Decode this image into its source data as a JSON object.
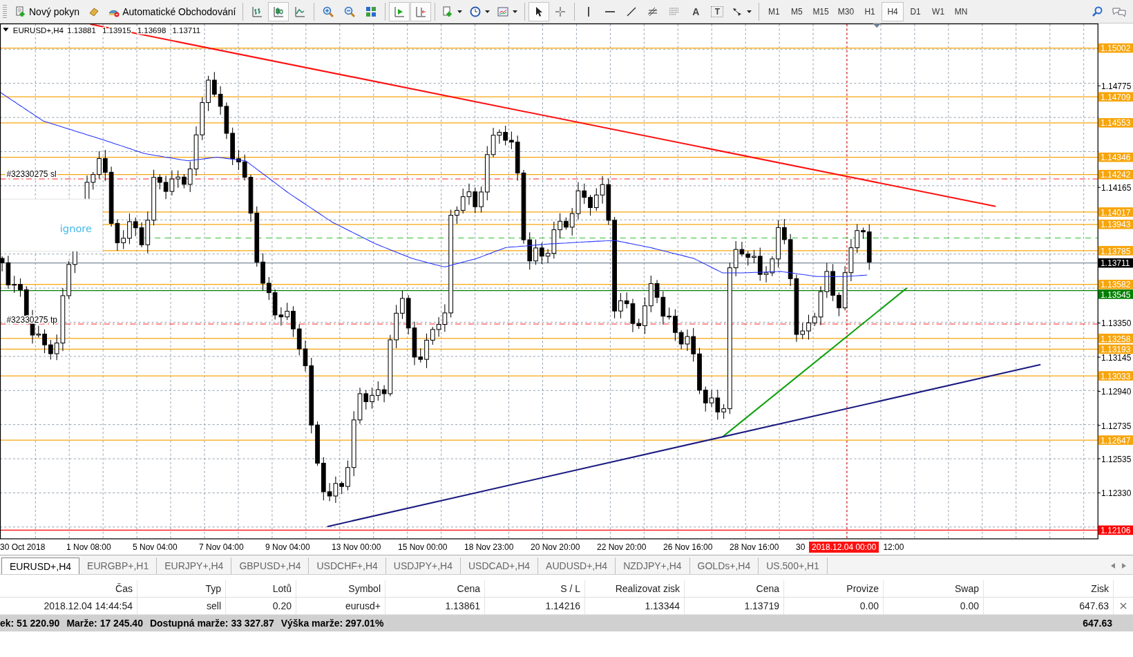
{
  "toolbar": {
    "groups": [
      [
        {
          "kind": "new-order",
          "label": "Nový pokyn",
          "selected": false
        },
        {
          "kind": "gold",
          "selected": false
        },
        {
          "kind": "auto-trading",
          "label": "Automatické Obchodování",
          "selected": false
        }
      ],
      [
        {
          "kind": "bar-chart",
          "selected": false
        },
        {
          "kind": "candles",
          "selected": true
        },
        {
          "kind": "line-chart",
          "selected": false
        }
      ],
      [
        {
          "kind": "zoom-in",
          "selected": false
        },
        {
          "kind": "zoom-out",
          "selected": false
        },
        {
          "kind": "tiles",
          "selected": false
        }
      ],
      [
        {
          "kind": "autoscroll",
          "selected": true
        },
        {
          "kind": "shift",
          "selected": true
        }
      ],
      [
        {
          "kind": "indicators",
          "selected": false,
          "dropdown": true
        },
        {
          "kind": "clock",
          "selected": false,
          "dropdown": true
        },
        {
          "kind": "templates",
          "selected": false,
          "dropdown": true
        }
      ],
      [
        {
          "kind": "cursor",
          "selected": true
        },
        {
          "kind": "crosshair",
          "selected": false
        }
      ],
      [
        {
          "kind": "vline",
          "selected": false
        },
        {
          "kind": "hline",
          "selected": false
        },
        {
          "kind": "trend",
          "selected": false
        },
        {
          "kind": "fan",
          "selected": false
        },
        {
          "kind": "dots",
          "selected": false
        },
        {
          "kind": "text",
          "label": "A",
          "selected": false
        },
        {
          "kind": "textbox",
          "label": "T",
          "selected": false
        },
        {
          "kind": "arrows",
          "selected": false,
          "dropdown": true
        }
      ]
    ],
    "timeframes": [
      {
        "label": "M1",
        "selected": false
      },
      {
        "label": "M5",
        "selected": false
      },
      {
        "label": "M15",
        "selected": false
      },
      {
        "label": "M30",
        "selected": false
      },
      {
        "label": "H1",
        "selected": false
      },
      {
        "label": "H4",
        "selected": true
      },
      {
        "label": "D1",
        "selected": false
      },
      {
        "label": "W1",
        "selected": false
      },
      {
        "label": "MN",
        "selected": false
      }
    ]
  },
  "chart": {
    "header": [
      "EURUSD+,H4",
      "1.13881",
      "1.13915",
      "1.13698",
      "1.13711"
    ],
    "price_ticks": [
      "1.14775",
      "1.14165",
      "1.13350",
      "1.13145",
      "1.12940",
      "1.12735",
      "1.12535",
      "1.12330"
    ],
    "price_tags": [
      {
        "text": "1.15002",
        "kind": "level",
        "color": "#f7a50c"
      },
      {
        "text": "1.14709",
        "kind": "level",
        "color": "#f7a50c"
      },
      {
        "text": "1.14553",
        "kind": "level",
        "color": "#f7a50c"
      },
      {
        "text": "1.14346",
        "kind": "level",
        "color": "#f7a50c"
      },
      {
        "text": "1.14242",
        "kind": "level",
        "color": "#f7a50c"
      },
      {
        "text": "1.14017",
        "kind": "level",
        "color": "#f7a50c"
      },
      {
        "text": "1.13943",
        "kind": "level",
        "color": "#f7a50c"
      },
      {
        "text": "1.13785",
        "kind": "level",
        "color": "#f7a50c"
      },
      {
        "text": "1.13711",
        "kind": "bid",
        "color": "#000000"
      },
      {
        "text": "1.13582",
        "kind": "level",
        "color": "#f7a50c"
      },
      {
        "text": "1.13545",
        "kind": "level",
        "color": "#008000"
      },
      {
        "text": "1.13258",
        "kind": "level",
        "color": "#f7a50c"
      },
      {
        "text": "1.13193",
        "kind": "level",
        "color": "#f7a50c"
      },
      {
        "text": "1.13033",
        "kind": "level",
        "color": "#f7a50c"
      },
      {
        "text": "1.12647",
        "kind": "level",
        "color": "#f7a50c"
      },
      {
        "text": "1.12106",
        "kind": "level",
        "color": "#ff0000"
      }
    ],
    "order_labels": [
      {
        "kind": "sl",
        "text": "#32330275 sl"
      },
      {
        "kind": "tp",
        "text": "#32330275 tp"
      }
    ],
    "popup": {
      "text": "ignore"
    },
    "time_labels": [
      "30 Oct 2018",
      "1 Nov 08:00",
      "5 Nov 04:00",
      "7 Nov 04:00",
      "9 Nov 04:00",
      "13 Nov 00:00",
      "15 Nov 00:00",
      "18 Nov 23:00",
      "20 Nov 20:00",
      "22 Nov 20:00",
      "26 Nov 16:00",
      "28 Nov 16:00",
      "30"
    ],
    "time_marker": "2018.12.04 00:00",
    "time_after": "12:00"
  },
  "tabs": [
    {
      "label": "EURUSD+,H4",
      "selected": true
    },
    {
      "label": "EURGBP+,H1",
      "selected": false
    },
    {
      "label": "EURJPY+,H4",
      "selected": false
    },
    {
      "label": "GBPUSD+,H4",
      "selected": false
    },
    {
      "label": "USDCHF+,H4",
      "selected": false
    },
    {
      "label": "USDJPY+,H4",
      "selected": false
    },
    {
      "label": "USDCAD+,H4",
      "selected": false
    },
    {
      "label": "AUDUSD+,H4",
      "selected": false
    },
    {
      "label": "NZDJPY+,H4",
      "selected": false
    },
    {
      "label": "GOLDs+,H4",
      "selected": false
    },
    {
      "label": "US.500+,H1",
      "selected": false
    }
  ],
  "table": {
    "columns": [
      "Čas",
      "Typ",
      "Lotů",
      "Symbol",
      "Cena",
      "S / L",
      "Realizovat zisk",
      "Cena",
      "Provize",
      "Swap",
      "Zisk"
    ],
    "rows": [
      {
        "cells": [
          "2018.12.04 14:44:54",
          "sell",
          "0.20",
          "eurusd+",
          "1.13861",
          "1.14216",
          "1.13344",
          "1.13719",
          "0.00",
          "0.00",
          "647.63"
        ]
      }
    ],
    "footer": [
      "ek: 51 220.90",
      "Marže: 17 245.40",
      "Dostupná marže: 33 327.87",
      "Výška marže: 297.01%"
    ],
    "footer_total": "647.63"
  }
}
